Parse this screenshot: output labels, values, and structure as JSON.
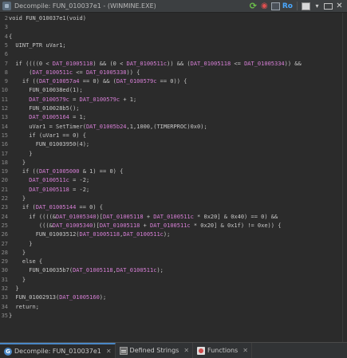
{
  "window": {
    "title": "Decompile: FUN_010037e1 -  (WINMINE.EXE)",
    "toolbar": {
      "refresh_icon": "refresh-icon",
      "snapshot_icon": "snapshot-icon",
      "copy_icon": "copy-icon",
      "ro_label": "Ro",
      "page_icon": "export-icon",
      "menu_glyph": "▾",
      "max_icon": "maximize-icon",
      "close_glyph": "✕"
    }
  },
  "code_lines": [
    {
      "n": "2",
      "segs": [
        [
          "t",
          "void FUN_010037e1(void)"
        ]
      ]
    },
    {
      "n": "3",
      "segs": []
    },
    {
      "n": "4",
      "segs": [
        [
          "t",
          "{"
        ]
      ]
    },
    {
      "n": "5",
      "segs": [
        [
          "t",
          "  UINT_PTR uVar1;"
        ]
      ]
    },
    {
      "n": "6",
      "segs": []
    },
    {
      "n": "7",
      "segs": [
        [
          "t",
          "  if ((((0 < "
        ],
        [
          "d",
          "DAT_01005118"
        ],
        [
          "t",
          ") && (0 < "
        ],
        [
          "d",
          "DAT_0100511c"
        ],
        [
          "t",
          ")) && ("
        ],
        [
          "d",
          "DAT_01005118"
        ],
        [
          "t",
          " <= "
        ],
        [
          "d",
          "DAT_01005334"
        ],
        [
          "t",
          ")) &&"
        ]
      ]
    },
    {
      "n": "8",
      "segs": [
        [
          "t",
          "      ("
        ],
        [
          "d",
          "DAT_0100511c"
        ],
        [
          "t",
          " <= "
        ],
        [
          "d",
          "DAT_01005338"
        ],
        [
          "t",
          ")) {"
        ]
      ]
    },
    {
      "n": "9",
      "segs": [
        [
          "t",
          "    if (("
        ],
        [
          "d",
          "DAT_010057a4"
        ],
        [
          "t",
          " == 0) && ("
        ],
        [
          "d",
          "DAT_0100579c"
        ],
        [
          "t",
          " == 0)) {"
        ]
      ]
    },
    {
      "n": "10",
      "segs": [
        [
          "t",
          "      FUN_010038ed(1);"
        ]
      ]
    },
    {
      "n": "11",
      "segs": [
        [
          "t",
          "      "
        ],
        [
          "d",
          "DAT_0100579c"
        ],
        [
          "t",
          " = "
        ],
        [
          "d",
          "DAT_0100579c"
        ],
        [
          "t",
          " + 1;"
        ]
      ]
    },
    {
      "n": "12",
      "segs": [
        [
          "t",
          "      FUN_010028b5();"
        ]
      ]
    },
    {
      "n": "13",
      "segs": [
        [
          "t",
          "      "
        ],
        [
          "d",
          "DAT_01005164"
        ],
        [
          "t",
          " = 1;"
        ]
      ]
    },
    {
      "n": "14",
      "segs": [
        [
          "t",
          "      uVar1 = SetTimer("
        ],
        [
          "d",
          "DAT_01005b24"
        ],
        [
          "t",
          ",1,1000,(TIMERPROC)0x0);"
        ]
      ]
    },
    {
      "n": "15",
      "segs": [
        [
          "t",
          "      if (uVar1 == 0) {"
        ]
      ]
    },
    {
      "n": "16",
      "segs": [
        [
          "t",
          "        FUN_01003950(4);"
        ]
      ]
    },
    {
      "n": "17",
      "segs": [
        [
          "t",
          "      }"
        ]
      ]
    },
    {
      "n": "18",
      "segs": [
        [
          "t",
          "    }"
        ]
      ]
    },
    {
      "n": "19",
      "segs": [
        [
          "t",
          "    if (("
        ],
        [
          "d",
          "DAT_01005000"
        ],
        [
          "t",
          " & 1) == 0) {"
        ]
      ]
    },
    {
      "n": "20",
      "segs": [
        [
          "t",
          "      "
        ],
        [
          "d",
          "DAT_0100511c"
        ],
        [
          "t",
          " = -2;"
        ]
      ]
    },
    {
      "n": "21",
      "segs": [
        [
          "t",
          "      "
        ],
        [
          "d",
          "DAT_01005118"
        ],
        [
          "t",
          " = -2;"
        ]
      ]
    },
    {
      "n": "22",
      "segs": [
        [
          "t",
          "    }"
        ]
      ]
    },
    {
      "n": "23",
      "segs": [
        [
          "t",
          "    if ("
        ],
        [
          "d",
          "DAT_01005144"
        ],
        [
          "t",
          " == 0) {"
        ]
      ]
    },
    {
      "n": "24",
      "segs": [
        [
          "t",
          "      if ((((&"
        ],
        [
          "d",
          "DAT_01005340"
        ],
        [
          "t",
          ")["
        ],
        [
          "d",
          "DAT_01005118"
        ],
        [
          "t",
          " + "
        ],
        [
          "d",
          "DAT_0100511c"
        ],
        [
          "t",
          " * 0x20] & 0x40) == 0) &&"
        ]
      ]
    },
    {
      "n": "25",
      "segs": [
        [
          "t",
          "         (((&"
        ],
        [
          "d",
          "DAT_01005340"
        ],
        [
          "t",
          ")["
        ],
        [
          "d",
          "DAT_01005118"
        ],
        [
          "t",
          " + "
        ],
        [
          "d",
          "DAT_0100511c"
        ],
        [
          "t",
          " * 0x20] & 0x1f) != 0xe)) {"
        ]
      ]
    },
    {
      "n": "26",
      "segs": [
        [
          "t",
          "        FUN_01003512("
        ],
        [
          "d",
          "DAT_01005118"
        ],
        [
          "t",
          ","
        ],
        [
          "d",
          "DAT_0100511c"
        ],
        [
          "t",
          ");"
        ]
      ]
    },
    {
      "n": "27",
      "segs": [
        [
          "t",
          "      }"
        ]
      ]
    },
    {
      "n": "28",
      "segs": [
        [
          "t",
          "    }"
        ]
      ]
    },
    {
      "n": "29",
      "segs": [
        [
          "t",
          "    else {"
        ]
      ]
    },
    {
      "n": "30",
      "segs": [
        [
          "t",
          "      FUN_010035b7("
        ],
        [
          "d",
          "DAT_01005118"
        ],
        [
          "t",
          ","
        ],
        [
          "d",
          "DAT_0100511c"
        ],
        [
          "t",
          ");"
        ]
      ]
    },
    {
      "n": "31",
      "segs": [
        [
          "t",
          "    }"
        ]
      ]
    },
    {
      "n": "32",
      "segs": [
        [
          "t",
          "  }"
        ]
      ]
    },
    {
      "n": "33",
      "segs": [
        [
          "t",
          "  FUN_01002913("
        ],
        [
          "d",
          "DAT_01005160"
        ],
        [
          "t",
          ");"
        ]
      ]
    },
    {
      "n": "34",
      "segs": [
        [
          "t",
          "  return;"
        ]
      ]
    },
    {
      "n": "35",
      "segs": [
        [
          "t",
          "}"
        ]
      ]
    }
  ],
  "tabs": [
    {
      "label": "Decompile: FUN_010037e1",
      "icon": "decompile-icon",
      "close": "✕",
      "active": true
    },
    {
      "label": "Defined Strings",
      "icon": "strings-icon",
      "close": "✕",
      "active": false
    },
    {
      "label": "Functions",
      "icon": "functions-icon",
      "close": "✕",
      "active": false
    }
  ],
  "colors": {
    "background": "#2b2b2b",
    "text": "#c8c8c8",
    "global_data": "#d77fd6",
    "line_number": "#8a8a8a"
  }
}
